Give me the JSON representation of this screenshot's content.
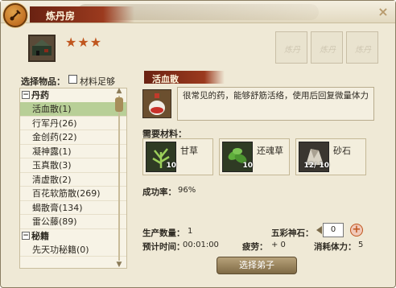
{
  "window": {
    "title": "炼丹房",
    "close_label": "×"
  },
  "header": {
    "stars": "★★★",
    "slot_label": "炼丹"
  },
  "left": {
    "select_label": "选择物品：",
    "filter_checkbox_label": "材料足够",
    "groups": [
      {
        "toggle": "−",
        "label": "丹药",
        "items": [
          "活血散(1)",
          "行军丹(26)",
          "金创药(22)",
          "凝神露(1)",
          "玉真散(3)",
          "清虚散(2)",
          "百花软筋散(269)",
          "蝎散膏(134)",
          "雷公藤(89)"
        ]
      },
      {
        "toggle": "−",
        "label": "秘籍",
        "items": [
          "先天功秘籍(0)"
        ]
      }
    ],
    "selected_index": 0
  },
  "detail": {
    "name": "活血散",
    "description": "很常见的药，能够舒筋活络，使用后回复微量体力",
    "materials_label": "需要材料：",
    "materials": [
      {
        "name": "甘草",
        "qty": "10",
        "icon": "herb-icon"
      },
      {
        "name": "还魂草",
        "qty": "10",
        "icon": "leaf-icon"
      },
      {
        "name": "砂石",
        "qty": "12/ 10",
        "icon": "stone-icon"
      }
    ],
    "success_label": "成功率：",
    "success_value": "96%"
  },
  "footer": {
    "quantity_label": "生产数量：",
    "quantity_value": "1",
    "stone_label": "五彩神石：",
    "stone_value": "0",
    "time_label": "预计时间：",
    "time_value": "00:01:00",
    "fatigue_label": "疲劳：",
    "fatigue_value": "+ 0",
    "stamina_label": "消耗体力：",
    "stamina_value": "5",
    "select_button": "选择弟子"
  }
}
